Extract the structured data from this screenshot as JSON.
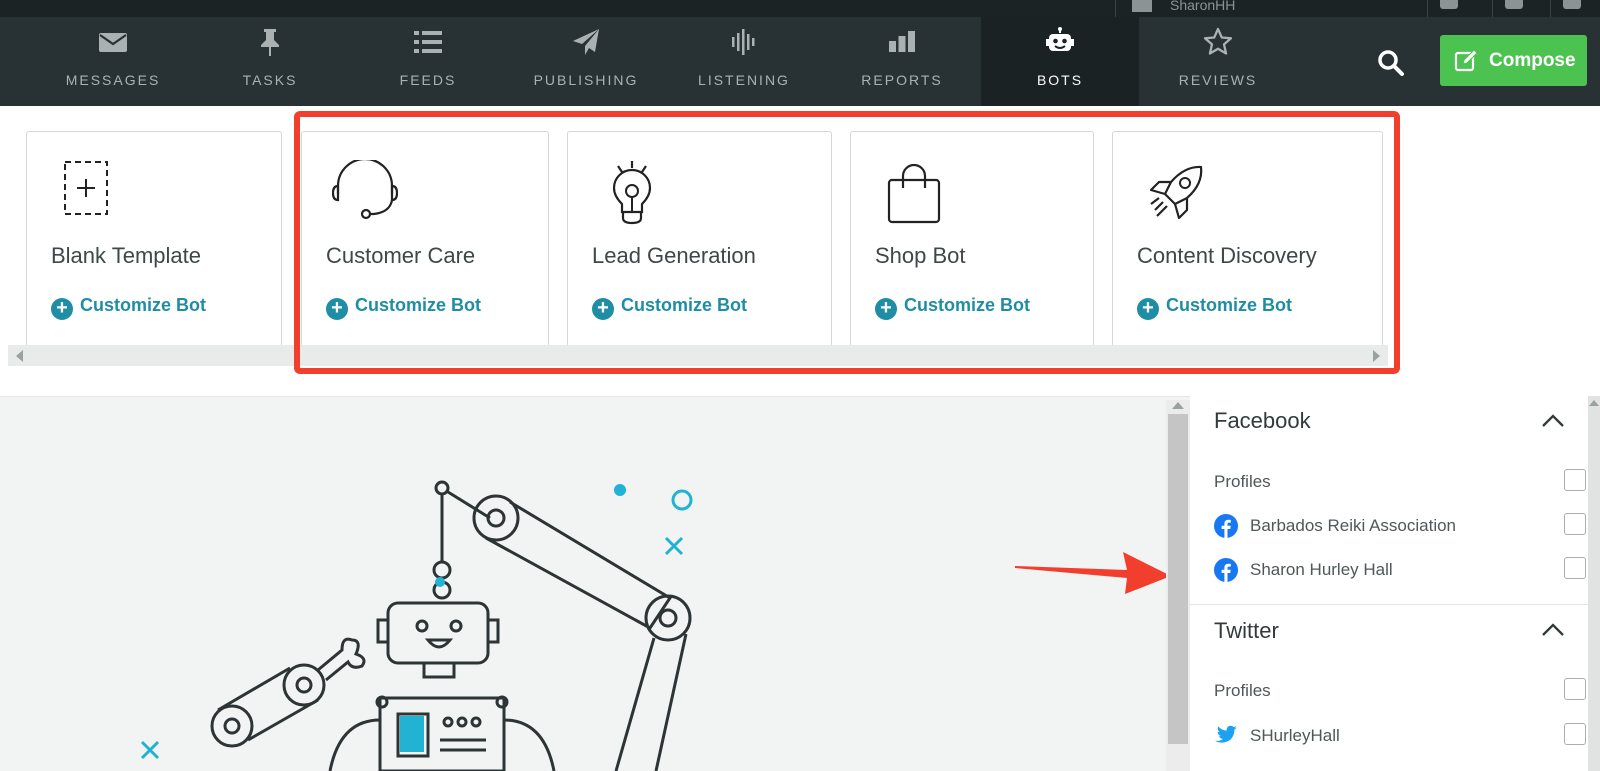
{
  "topbar": {
    "account_name": "SharonHH"
  },
  "nav": {
    "items": [
      {
        "label": "MESSAGES",
        "icon": "envelope-icon"
      },
      {
        "label": "TASKS",
        "icon": "pushpin-icon"
      },
      {
        "label": "FEEDS",
        "icon": "list-icon"
      },
      {
        "label": "PUBLISHING",
        "icon": "paper-plane-icon"
      },
      {
        "label": "LISTENING",
        "icon": "sound-wave-icon"
      },
      {
        "label": "REPORTS",
        "icon": "bar-chart-icon"
      },
      {
        "label": "BOTS",
        "icon": "robot-icon",
        "active": true
      },
      {
        "label": "REVIEWS",
        "icon": "star-icon"
      }
    ],
    "compose_label": "Compose"
  },
  "templates": [
    {
      "title": "Blank Template",
      "action": "Customize Bot",
      "icon": "dashed-plus-icon"
    },
    {
      "title": "Customer Care",
      "action": "Customize Bot",
      "icon": "headset-icon"
    },
    {
      "title": "Lead Generation",
      "action": "Customize Bot",
      "icon": "lightbulb-icon"
    },
    {
      "title": "Shop Bot",
      "action": "Customize Bot",
      "icon": "shopping-bag-icon"
    },
    {
      "title": "Content Discovery",
      "action": "Customize Bot",
      "icon": "rocket-icon"
    }
  ],
  "sidebar": {
    "sections": [
      {
        "network": "Facebook",
        "profiles_label": "Profiles",
        "profiles": [
          "Barbados Reiki Association",
          "Sharon Hurley Hall"
        ]
      },
      {
        "network": "Twitter",
        "profiles_label": "Profiles",
        "profiles": [
          "SHurleyHall"
        ]
      }
    ]
  },
  "colors": {
    "nav_bg": "#283235",
    "nav_active_bg": "#1b2224",
    "compose_green": "#4cc351",
    "link_teal": "#1f8ea5",
    "highlight_red": "#f23f2d",
    "facebook_blue": "#1877f2",
    "twitter_blue": "#1da1f2"
  }
}
